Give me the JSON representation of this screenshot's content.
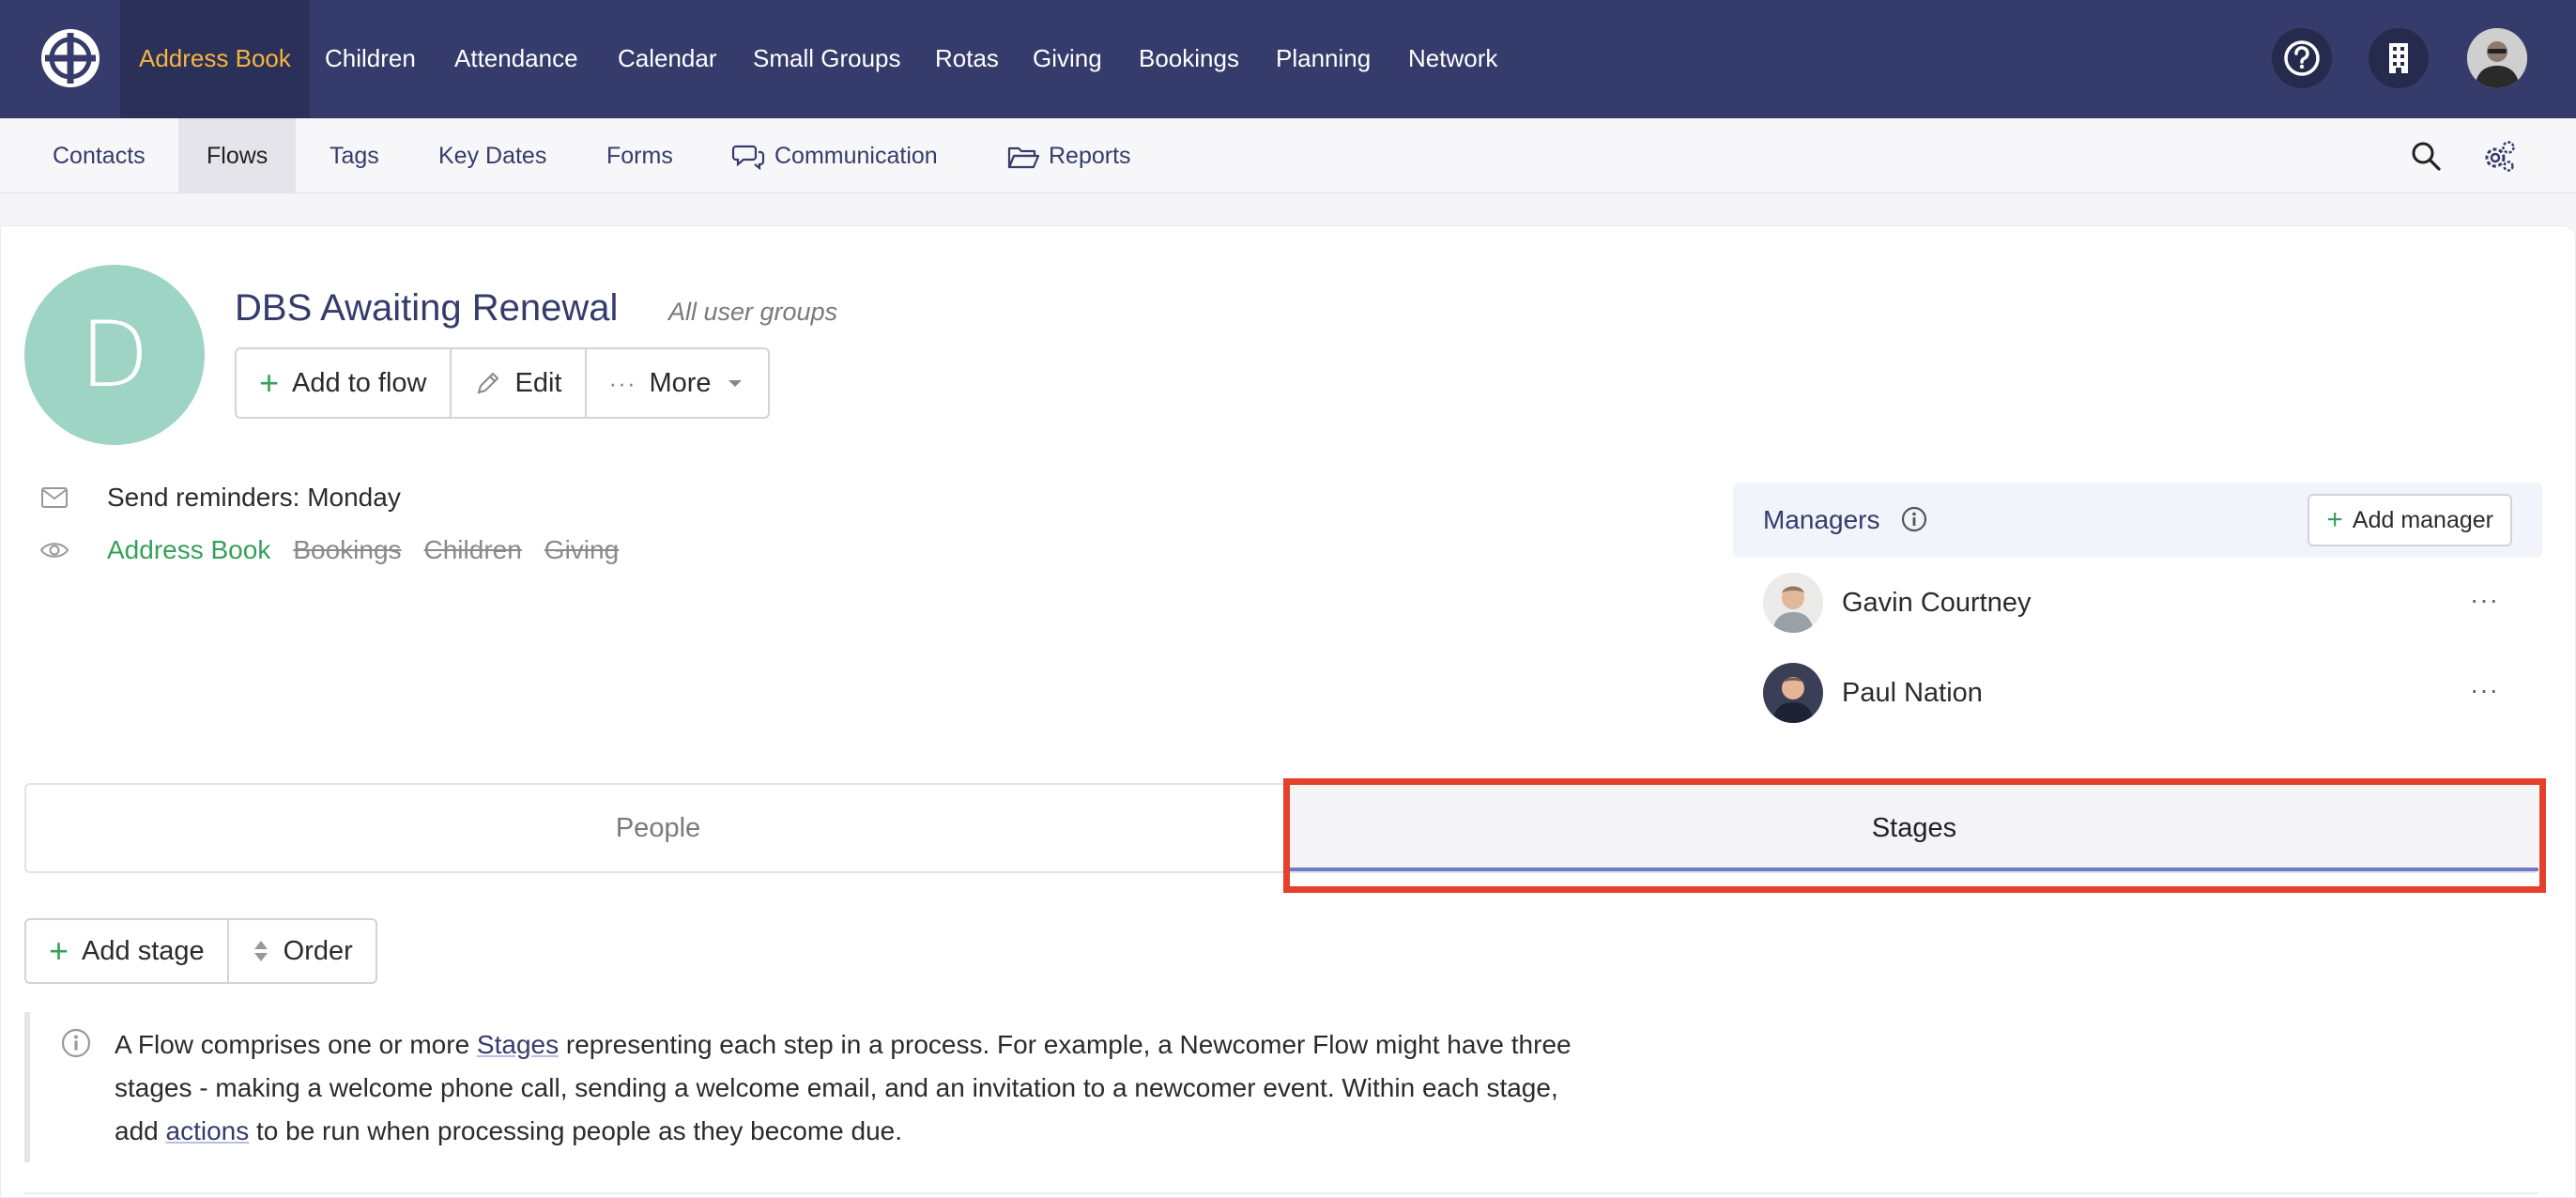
{
  "topnav": {
    "items": [
      {
        "label": "Address Book",
        "active": true
      },
      {
        "label": "Children"
      },
      {
        "label": "Attendance"
      },
      {
        "label": "Calendar"
      },
      {
        "label": "Small Groups"
      },
      {
        "label": "Rotas"
      },
      {
        "label": "Giving"
      },
      {
        "label": "Bookings"
      },
      {
        "label": "Planning"
      },
      {
        "label": "Network"
      }
    ],
    "icons": [
      "help-icon",
      "building-icon",
      "user-avatar"
    ]
  },
  "subnav": {
    "items": [
      {
        "label": "Contacts"
      },
      {
        "label": "Flows",
        "active": true
      },
      {
        "label": "Tags"
      },
      {
        "label": "Key Dates"
      },
      {
        "label": "Forms"
      },
      {
        "label": "Communication",
        "icon": "chat-icon"
      },
      {
        "label": "Reports",
        "icon": "folder-icon"
      }
    ],
    "icons": [
      "search-icon",
      "settings-icon"
    ]
  },
  "flow": {
    "avatar_letter": "D",
    "title": "DBS Awaiting Renewal",
    "subtitle": "All user groups",
    "actions": {
      "add_to_flow": "Add to flow",
      "edit": "Edit",
      "more": "More"
    },
    "reminders": "Send reminders: Monday",
    "modules": [
      {
        "label": "Address Book",
        "enabled": true
      },
      {
        "label": "Bookings",
        "enabled": false
      },
      {
        "label": "Children",
        "enabled": false
      },
      {
        "label": "Giving",
        "enabled": false
      }
    ]
  },
  "managers": {
    "label": "Managers",
    "add_label": "Add manager",
    "list": [
      {
        "name": "Gavin Courtney"
      },
      {
        "name": "Paul Nation"
      }
    ]
  },
  "tabs": {
    "people": "People",
    "stages": "Stages",
    "active": "Stages"
  },
  "stages": {
    "add_stage": "Add stage",
    "order": "Order"
  },
  "info": {
    "part1": "A Flow comprises one or more ",
    "link1": "Stages",
    "part2": " representing each step in a process. For example, a Newcomer Flow might have three stages - making a welcome phone call, sending a welcome email, and an invitation to a newcomer event. Within each stage, add ",
    "link2": "actions",
    "part3": " to be run when processing people as they become due."
  },
  "colors": {
    "nav_bg": "#353c6b",
    "nav_active_text": "#f5b540",
    "accent_green": "#35a05a",
    "highlight": "#e5402c",
    "tab_underline": "#6e79c9"
  }
}
